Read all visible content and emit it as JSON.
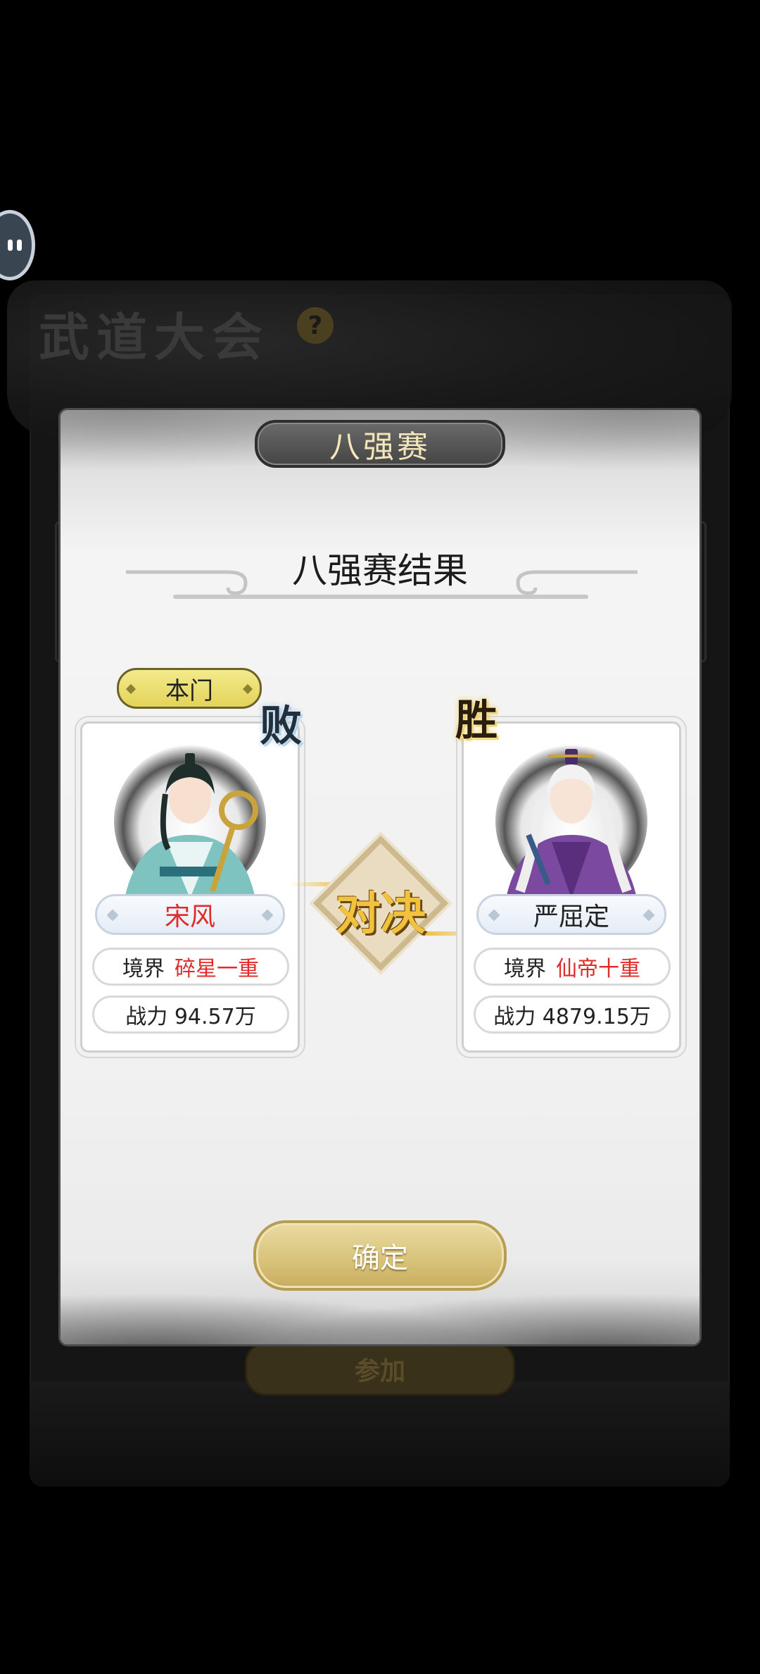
{
  "background": {
    "title": "武道大会",
    "help_icon": "?",
    "join_label": "参加"
  },
  "dialog": {
    "title": "八强赛",
    "result_heading": "八强赛结果",
    "vs_label": "对决",
    "confirm_label": "确定",
    "fighters": [
      {
        "tag": "本门",
        "result": "败",
        "name": "宋风",
        "realm_label": "境界",
        "realm_value": "碎星一重",
        "power_text": "战力 94.57万"
      },
      {
        "result": "胜",
        "name": "严屈定",
        "realm_label": "境界",
        "realm_value": "仙帝十重",
        "power_text": "战力 4879.15万"
      }
    ]
  },
  "colors": {
    "accent_gold": "#f2c23d",
    "realm_red": "#e02b2b",
    "home_tag": "#e3d35a"
  }
}
